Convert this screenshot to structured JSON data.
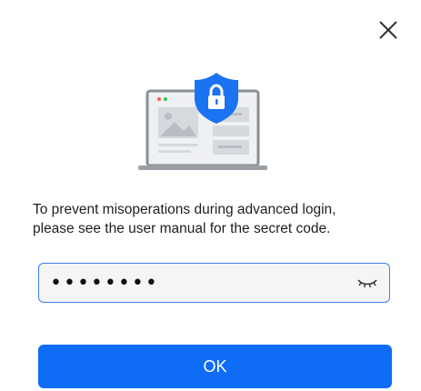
{
  "dialog": {
    "message_line1": "To prevent misoperations during advanced login,",
    "message_line2": "please see the user manual for the secret code.",
    "password_value": "secret12",
    "ok_label": "OK"
  },
  "icons": {
    "close": "close-icon",
    "eye_toggle": "eye-closed-icon",
    "illustration": "laptop-shield-lock-illustration"
  },
  "colors": {
    "accent": "#0f6cf7",
    "field_border": "#3d7ff3",
    "field_bg": "#f5f5f5",
    "shield": "#1a73f0"
  }
}
